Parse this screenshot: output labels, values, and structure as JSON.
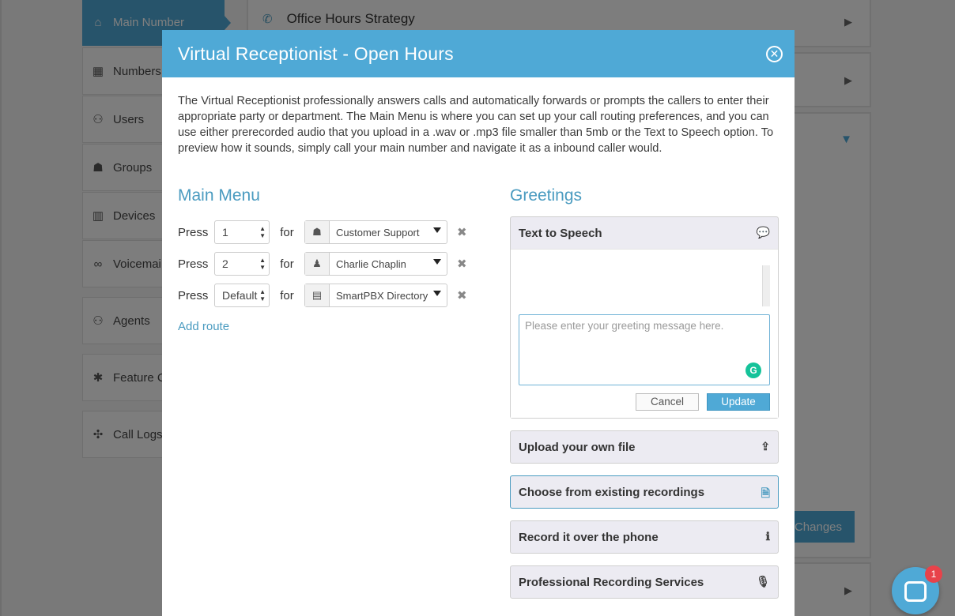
{
  "sidebar": {
    "items": [
      {
        "label": "Main Number",
        "icon": "home-icon",
        "glyph": "⌂"
      },
      {
        "label": "Numbers",
        "icon": "grid-icon",
        "glyph": "▦"
      },
      {
        "label": "Users",
        "icon": "users-icon",
        "glyph": "⚇"
      },
      {
        "label": "Groups",
        "icon": "group-icon",
        "glyph": "☗"
      },
      {
        "label": "Devices",
        "icon": "devices-icon",
        "glyph": "▥"
      },
      {
        "label": "Voicemai",
        "icon": "voicemail-icon",
        "glyph": "∞"
      },
      {
        "label": "Agents",
        "icon": "agents-icon",
        "glyph": "⚇"
      },
      {
        "label": "Feature Co",
        "icon": "asterisk-icon",
        "glyph": "✱"
      },
      {
        "label": "Call Logs",
        "icon": "call-logs-icon",
        "glyph": "✣"
      }
    ]
  },
  "background": {
    "panel_title": "Office Hours Strategy",
    "save_label": "Changes"
  },
  "modal": {
    "title": "Virtual Receptionist - Open Hours",
    "intro": "The Virtual Receptionist professionally answers calls and automatically forwards or prompts the callers to enter their appropriate party or department. The Main Menu is where you can set up your call routing preferences, and you can use either prerecorded audio that you upload in a .wav or .mp3 file smaller than 5mb or the Text to Speech option. To preview how it sounds, simply call your main number and navigate it as a inbound caller would."
  },
  "main_menu": {
    "title": "Main Menu",
    "press_label": "Press",
    "for_label": "for",
    "routes": [
      {
        "key": "1",
        "destination": "Customer Support",
        "icon": "group-icon"
      },
      {
        "key": "2",
        "destination": "Charlie Chaplin",
        "icon": "user-icon"
      },
      {
        "key": "Default",
        "destination": "SmartPBX Directory",
        "icon": "directory-icon"
      }
    ],
    "add_route": "Add route"
  },
  "greetings": {
    "title": "Greetings",
    "tts": {
      "label": "Text to Speech",
      "placeholder": "Please enter your greeting message here.",
      "cancel": "Cancel",
      "update": "Update"
    },
    "options": [
      {
        "label": "Upload your own file",
        "icon": "upload-icon"
      },
      {
        "label": "Choose from existing recordings",
        "icon": "audio-file-icon"
      },
      {
        "label": "Record it over the phone",
        "icon": "info-icon"
      },
      {
        "label": "Professional Recording Services",
        "icon": "microphone-icon"
      }
    ]
  },
  "chat": {
    "badge_count": "1"
  }
}
